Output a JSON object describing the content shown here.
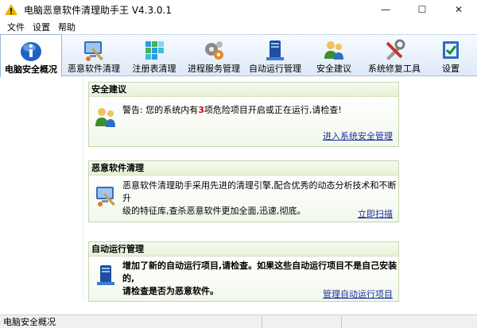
{
  "window": {
    "title": "电脑恶意软件清理助手王 V4.3.0.1",
    "minimize_glyph": "—",
    "maximize_glyph": "☐",
    "close_glyph": "✕"
  },
  "menu": [
    "文件",
    "设置",
    "帮助"
  ],
  "toolbar": [
    {
      "label": "电脑安全概况",
      "icon": "info-icon",
      "active": true
    },
    {
      "label": "恶意软件清理",
      "icon": "malware-clean-icon",
      "active": false
    },
    {
      "label": "注册表清理",
      "icon": "registry-icon",
      "active": false
    },
    {
      "label": "进程服务管理",
      "icon": "gears-icon",
      "active": false
    },
    {
      "label": "自动运行管理",
      "icon": "autorun-icon",
      "active": false
    },
    {
      "label": "安全建议",
      "icon": "users-icon",
      "active": false
    },
    {
      "label": "系统修复工具",
      "icon": "tools-icon",
      "active": false
    },
    {
      "label": "设置",
      "icon": "settings-icon",
      "active": false
    }
  ],
  "panels": {
    "security": {
      "title": "安全建议",
      "text_before": "警告: 您的系统内有",
      "count": "3",
      "text_after": "项危险项目开启或正在运行,请检查!",
      "link": "进入系统安全管理"
    },
    "malware": {
      "title": "恶意软件清理",
      "line1": "恶意软件清理助手采用先进的清理引擎,配合优秀的动态分析技术和不断升",
      "line2": "级的特征库,查杀恶意软件更加全面,迅速,彻底。",
      "link": "立即扫描"
    },
    "autorun": {
      "title": "自动运行管理",
      "line1": "增加了新的自动运行项目,请检查。如果这些自动运行项目不是自己安装的,",
      "line2": "请检查是否为恶意软件。",
      "link": "管理自动运行项目"
    }
  },
  "status": {
    "text": "电脑安全概况"
  },
  "colors": {
    "link": "#1a2fa0",
    "warning": "#e30000",
    "panel_border": "#c2d7ad"
  }
}
